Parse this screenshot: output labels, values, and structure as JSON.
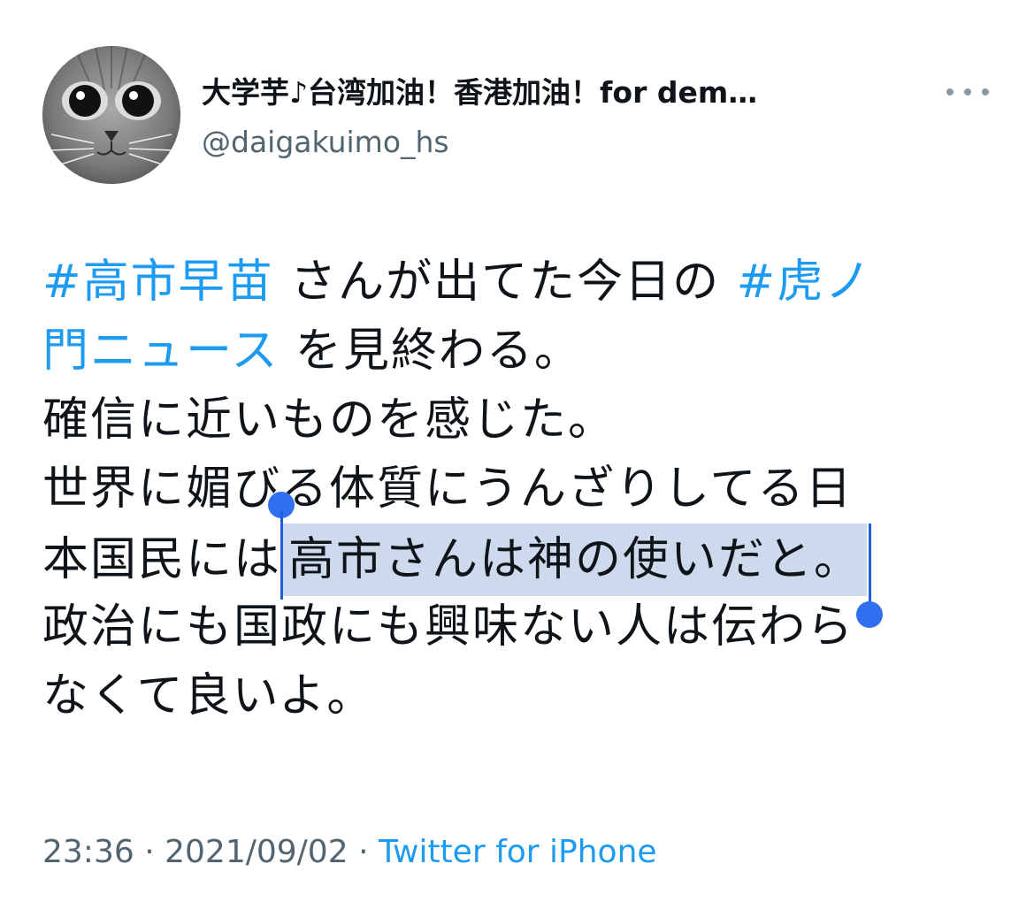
{
  "tweet": {
    "author": {
      "display_name": "大学芋♪台湾加油！香港加油！for dem…",
      "handle": "@daigakuimo_hs"
    },
    "body": {
      "line1": {
        "hashtag1": "#高市早苗",
        "text1": " さんが出てた今日の ",
        "hashtag2_part1": "#虎ノ"
      },
      "line2": {
        "hashtag2_part2": "門ニュース",
        "text": " を見終わる。"
      },
      "line3": "確信に近いものを感じた。",
      "line4": "世界に媚びる体質にうんざりしてる日",
      "line5": {
        "plain": "本国民には",
        "selected": "高市さんは神の使いだと。"
      },
      "line6": "政治にも国政にも興味ない人は伝わら",
      "line7": "なくて良いよ。"
    },
    "time": "23:36",
    "separator": "·",
    "date": "2021/09/02",
    "source": "Twitter for iPhone"
  },
  "colors": {
    "hashtag": "#1d9bf0",
    "selection": "#cdd9ec",
    "selection_handle": "#2f6ff0",
    "secondary_text": "#536471"
  },
  "icons": {
    "more": "more-horizontal-icon",
    "avatar": "cat-avatar"
  }
}
